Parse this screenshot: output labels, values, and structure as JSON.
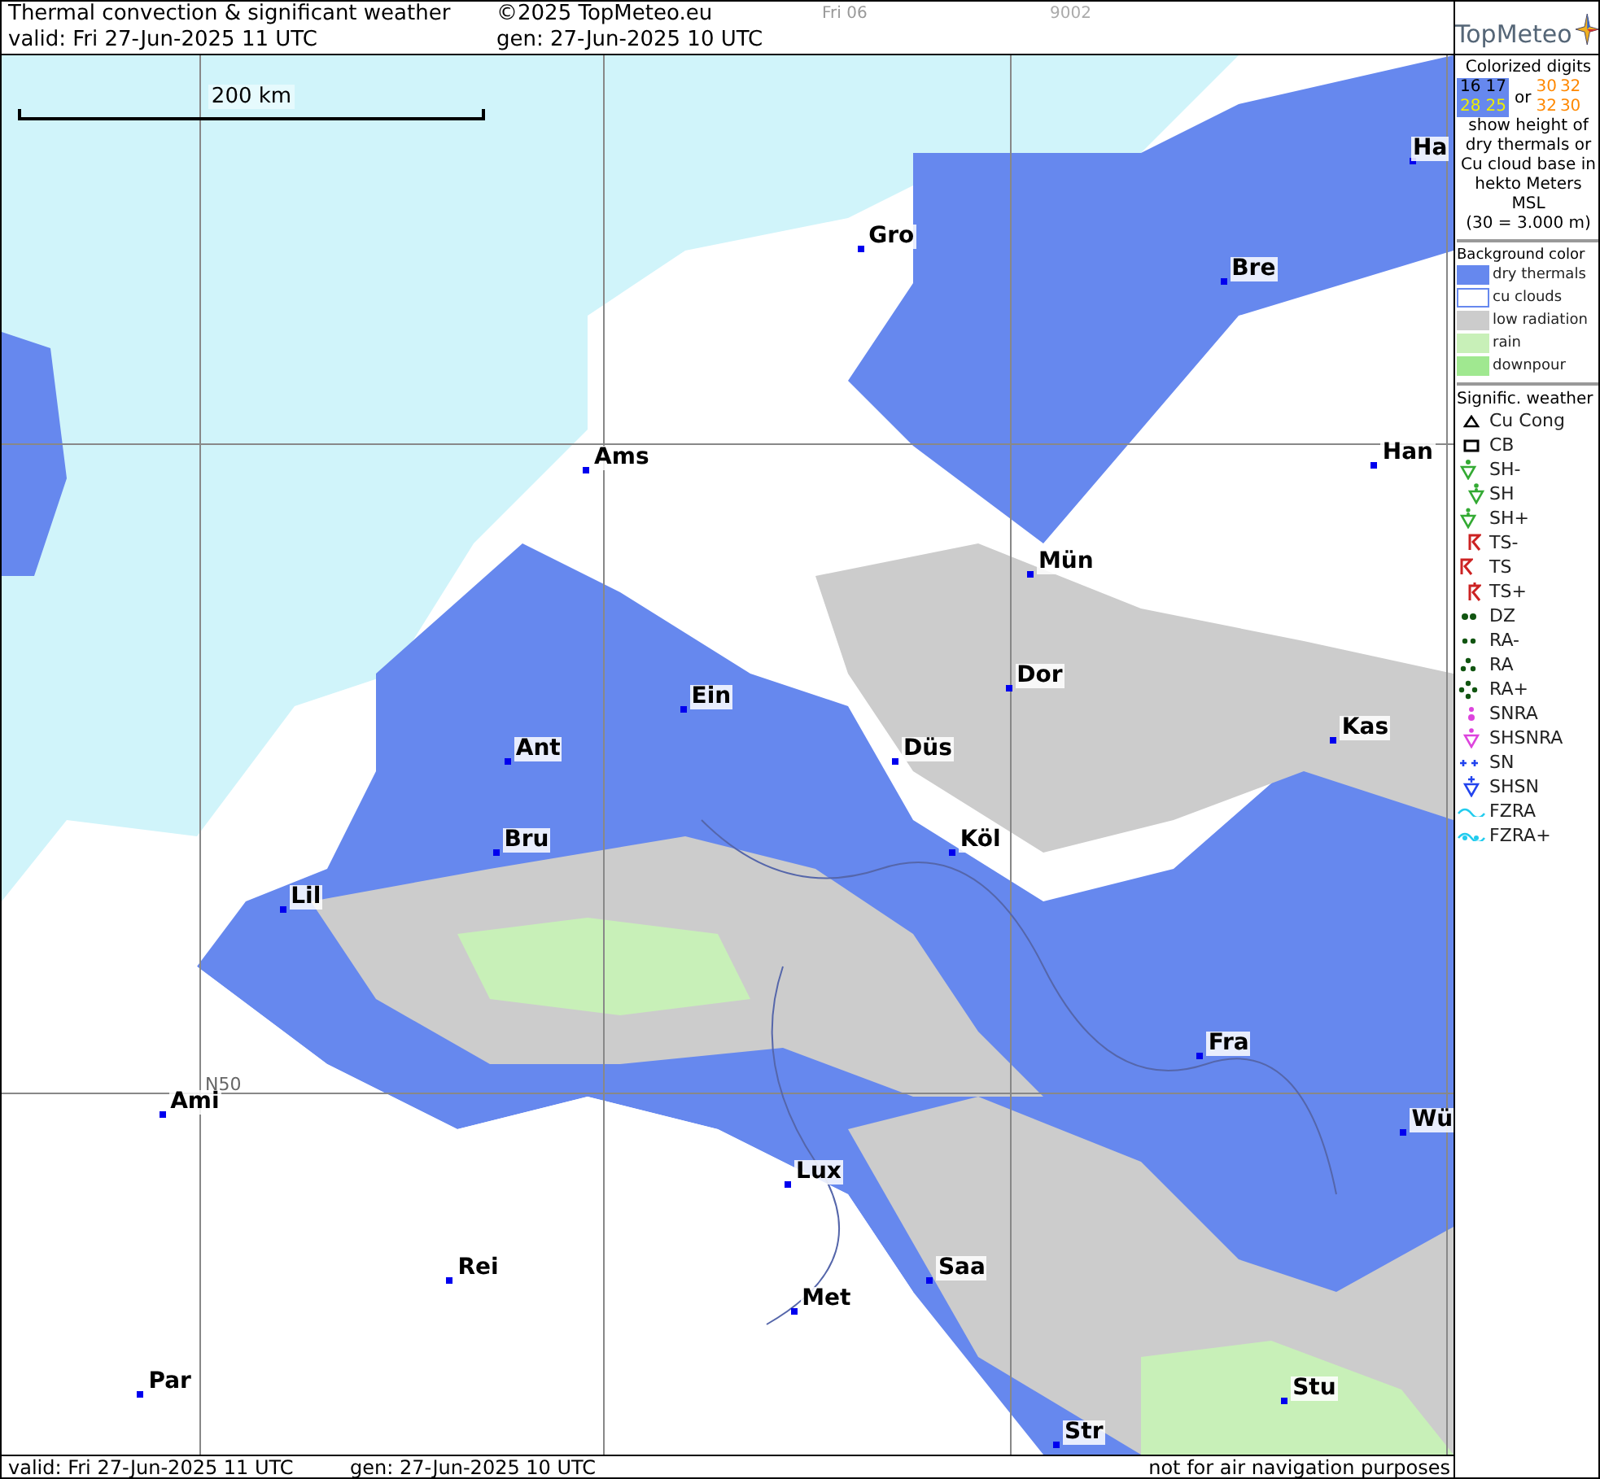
{
  "header": {
    "title": "Thermal convection & significant weather",
    "copyright": "©2025 TopMeteo.eu",
    "day": "Fri 06",
    "code": "9002",
    "valid": "valid:  Fri  27-Jun-2025  11 UTC",
    "gen": "gen: 27-Jun-2025 10 UTC",
    "logo": "TopMeteo"
  },
  "map": {
    "scale": "200 km",
    "grid_label": "N50",
    "cities": [
      "Gro",
      "Bre",
      "Ha",
      "Ams",
      "Han",
      "Mün",
      "Dor",
      "Ein",
      "Ant",
      "Düs",
      "Kas",
      "Bru",
      "Köl",
      "Lil",
      "Fra",
      "Ami",
      "Wü",
      "Lux",
      "Rei",
      "Saa",
      "Met",
      "Par",
      "Stu",
      "Str"
    ]
  },
  "legend": {
    "digits_title": "Colorized digits",
    "sample_a": [
      "16",
      "17",
      "28",
      "25"
    ],
    "or": "or",
    "sample_b": [
      "30",
      "32",
      "32",
      "30"
    ],
    "digits_note": "show height of dry thermals or Cu cloud base in hekto Meters MSL",
    "digits_example": "(30 = 3.000 m)",
    "background_title": "Background color",
    "backgrounds": [
      {
        "label": "dry thermals",
        "color": "#6688ee"
      },
      {
        "label": "cu clouds",
        "color": "#ffffff"
      },
      {
        "label": "low radiation",
        "color": "#cccccc"
      },
      {
        "label": "rain",
        "color": "#c8f0b8"
      },
      {
        "label": "downpour",
        "color": "#a0e890"
      }
    ],
    "weather_title": "Signific. weather",
    "weather": [
      {
        "kind": "cucong",
        "label": "Cu Cong"
      },
      {
        "kind": "cb",
        "label": "CB"
      },
      {
        "kind": "shower1",
        "label": "SH-"
      },
      {
        "kind": "shower2",
        "label": "SH"
      },
      {
        "kind": "shower3",
        "label": "SH+"
      },
      {
        "kind": "ts1",
        "label": "TS-"
      },
      {
        "kind": "ts2",
        "label": "TS"
      },
      {
        "kind": "ts3",
        "label": "TS+"
      },
      {
        "kind": "dz",
        "label": "DZ"
      },
      {
        "kind": "ra1",
        "label": "RA-"
      },
      {
        "kind": "ra2",
        "label": "RA"
      },
      {
        "kind": "ra3",
        "label": "RA+"
      },
      {
        "kind": "snra",
        "label": "SNRA"
      },
      {
        "kind": "shsnra",
        "label": "SHSNRA"
      },
      {
        "kind": "sn",
        "label": "SN"
      },
      {
        "kind": "shsn",
        "label": "SHSN"
      },
      {
        "kind": "fzra",
        "label": "FZRA"
      },
      {
        "kind": "fzra2",
        "label": "FZRA+"
      }
    ]
  },
  "footer": {
    "valid": "valid:  Fri  27-Jun-2025  11 UTC",
    "gen": "gen: 27-Jun-2025 10 UTC",
    "disclaimer": "not for air navigation purposes"
  }
}
